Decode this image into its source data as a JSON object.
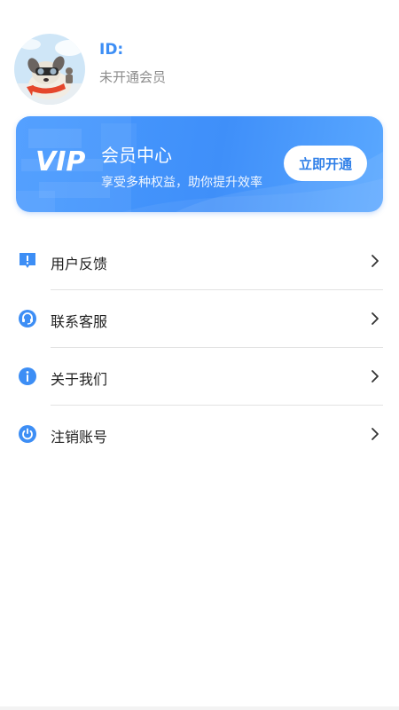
{
  "profile": {
    "id_label": "ID:",
    "member_status": "未开通会员"
  },
  "vip_banner": {
    "logo_text": "VIP",
    "title": "会员中心",
    "subtitle": "享受多种权益，助你提升效率",
    "button_label": "立即开通",
    "accent_color": "#3f8ff9"
  },
  "menu": {
    "items": [
      {
        "label": "用户反馈",
        "icon": "feedback-icon"
      },
      {
        "label": "联系客服",
        "icon": "headset-icon"
      },
      {
        "label": "关于我们",
        "icon": "info-icon"
      },
      {
        "label": "注销账号",
        "icon": "power-icon"
      }
    ]
  },
  "colors": {
    "id_text": "#3d8ef5",
    "icon_blue": "#3d8ef5",
    "muted_text": "#8c8c8c"
  }
}
